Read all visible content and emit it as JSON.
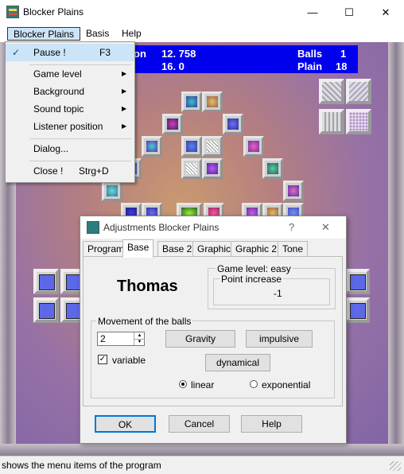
{
  "window": {
    "title": "Blocker Plains",
    "controls": {
      "minimize": "—",
      "maximize": "☐",
      "close": "✕"
    }
  },
  "menubar": {
    "items": [
      "Blocker Plains",
      "Basis",
      "Help"
    ]
  },
  "menu": {
    "pause": {
      "label": "Pause !",
      "accel": "F3",
      "check": "✓"
    },
    "game_level": "Game level",
    "background": "Background",
    "sound_topic": "Sound topic",
    "listener_position": "Listener position",
    "dialog": "Dialog...",
    "close": {
      "label": "Close !",
      "accel": "Strg+D"
    },
    "arrow": "▶"
  },
  "score": {
    "label1_suffix": "on",
    "value1": "12. 758",
    "value2": "16. 0",
    "balls_label": "Balls",
    "balls_value": "1",
    "plain_label": "Plain",
    "plain_value": "18"
  },
  "dialog": {
    "title": "Adjustments Blocker Plains",
    "help_glyph": "?",
    "close_glyph": "✕",
    "tabs": [
      "Program",
      "Base",
      "Base 2",
      "Graphic",
      "Graphic 2",
      "Tone"
    ],
    "active_tab": "Base",
    "player_name": "Thomas",
    "game_level": "Game level: easy",
    "point_increase_label": "Point increase",
    "point_increase_value": "-1",
    "movement_title": "Movement of the balls",
    "spin_value": "2",
    "gravity_button": "Gravity",
    "impulsive_button": "impulsive",
    "variable_label": "variable",
    "variable_checked": true,
    "dynamical_button": "dynamical",
    "linear_label": "linear",
    "exponential_label": "exponential",
    "selected_mode": "linear",
    "ok_button": "OK",
    "cancel_button": "Cancel",
    "help_button": "Help"
  },
  "status": {
    "text": "shows the menu items of the program"
  },
  "colors": {
    "score_bg": "#0000ee",
    "menu_highlight": "#cce4f7",
    "block_blue": "#5d68e8"
  }
}
